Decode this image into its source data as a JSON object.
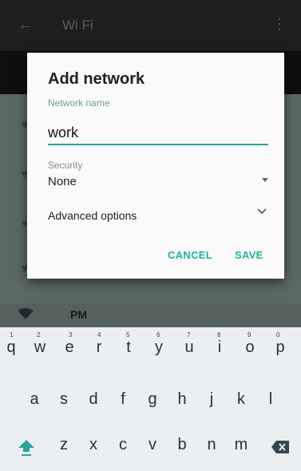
{
  "appbar": {
    "title": "Wi Fi",
    "back_icon": "arrow-back-icon",
    "more_icon": "more-vert-icon"
  },
  "dialog": {
    "title": "Add network",
    "network_name_label": "Network name",
    "network_name_value": "work",
    "security_label": "Security",
    "security_value": "None",
    "advanced_label": "Advanced options",
    "cancel_label": "CANCEL",
    "save_label": "SAVE",
    "accent": "#1fb39b"
  },
  "background": {
    "row_text": "PM"
  },
  "keyboard": {
    "row1": [
      "q",
      "w",
      "e",
      "r",
      "t",
      "y",
      "u",
      "i",
      "o",
      "p"
    ],
    "row1_hints": [
      "1",
      "2",
      "3",
      "4",
      "5",
      "6",
      "7",
      "8",
      "9",
      "0"
    ],
    "row2": [
      "a",
      "s",
      "d",
      "f",
      "g",
      "h",
      "j",
      "k",
      "l"
    ],
    "row3": [
      "z",
      "x",
      "c",
      "v",
      "b",
      "n",
      "m"
    ],
    "shift_icon": "shift-icon",
    "backspace_icon": "backspace-icon"
  }
}
